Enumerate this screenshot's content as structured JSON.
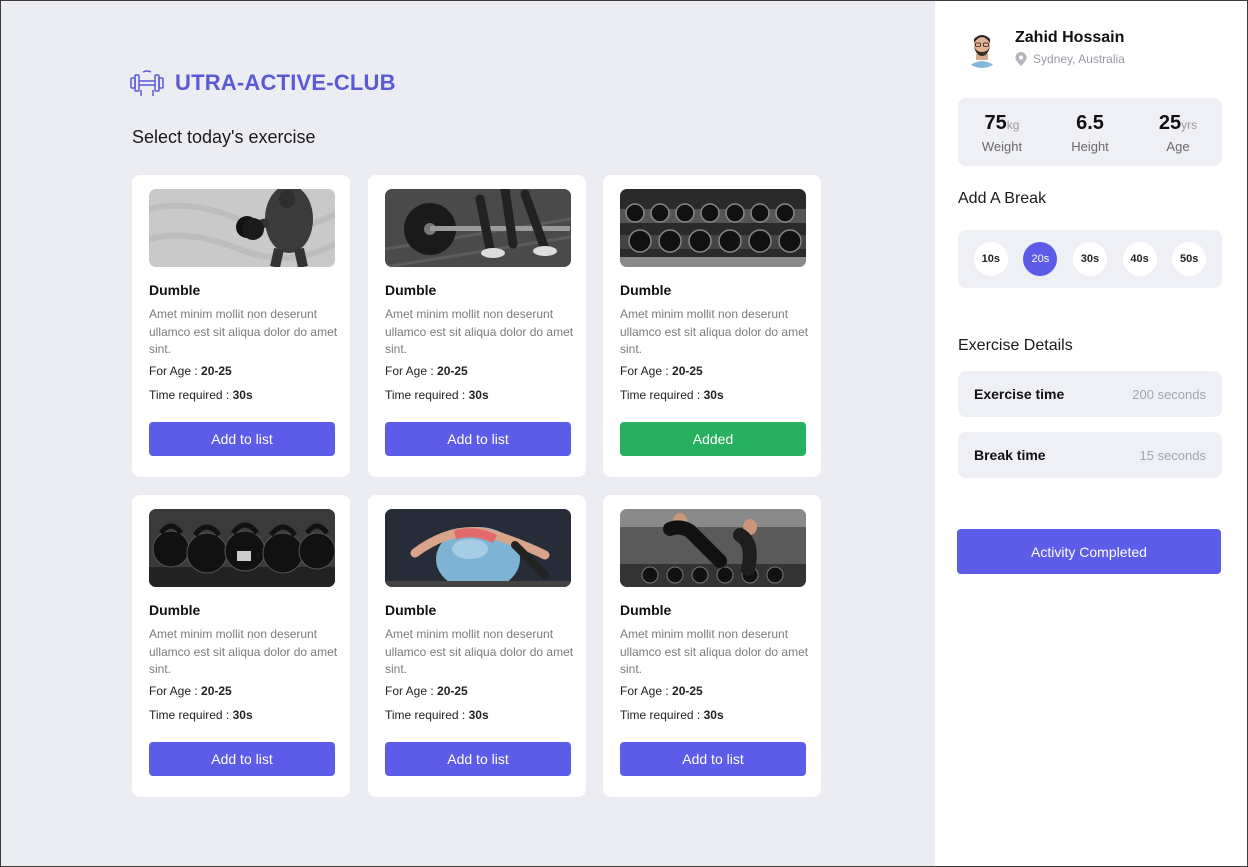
{
  "brand": {
    "name": "UTRA-ACTIVE-CLUB",
    "color": "#5b5ad6",
    "icon": "dumbbell-icon"
  },
  "section_title": "Select today's exercise",
  "labels": {
    "for_age": "For Age : ",
    "time_required": "Time required : "
  },
  "cards": [
    {
      "title": "Dumble",
      "desc": "Amet minim mollit non deserunt ullamco est sit aliqua dolor do amet sint.",
      "age": "20-25",
      "time": "30s",
      "button": "Add to list",
      "added": false,
      "image": "bodybuilder-curl"
    },
    {
      "title": "Dumble",
      "desc": "Amet minim mollit non deserunt ullamco est sit aliqua dolor do amet sint.",
      "age": "20-25",
      "time": "30s",
      "button": "Add to list",
      "added": false,
      "image": "barbell-floor"
    },
    {
      "title": "Dumble",
      "desc": "Amet minim mollit non deserunt ullamco est sit aliqua dolor do amet sint.",
      "age": "20-25",
      "time": "30s",
      "button": "Added",
      "added": true,
      "image": "dumbbell-rack"
    },
    {
      "title": "Dumble",
      "desc": "Amet minim mollit non deserunt ullamco est sit aliqua dolor do amet sint.",
      "age": "20-25",
      "time": "30s",
      "button": "Add to list",
      "added": false,
      "image": "kettlebells"
    },
    {
      "title": "Dumble",
      "desc": "Amet minim mollit non deserunt ullamco est sit aliqua dolor do amet sint.",
      "age": "20-25",
      "time": "30s",
      "button": "Add to list",
      "added": false,
      "image": "exercise-ball"
    },
    {
      "title": "Dumble",
      "desc": "Amet minim mollit non deserunt ullamco est sit aliqua dolor do amet sint.",
      "age": "20-25",
      "time": "30s",
      "button": "Add to list",
      "added": false,
      "image": "gym-trainer"
    }
  ],
  "profile": {
    "name": "Zahid Hossain",
    "location": "Sydney, Australia"
  },
  "stats": [
    {
      "value": "75",
      "unit": "kg",
      "label": "Weight"
    },
    {
      "value": "6.5",
      "unit": "",
      "label": "Height"
    },
    {
      "value": "25",
      "unit": "yrs",
      "label": "Age"
    }
  ],
  "break_section": {
    "title": "Add A Break",
    "options": [
      "10s",
      "20s",
      "30s",
      "40s",
      "50s"
    ],
    "selected": "20s"
  },
  "details": {
    "title": "Exercise Details",
    "exercise_label": "Exercise time",
    "exercise_value": "200 seconds",
    "break_label": "Break time",
    "break_value": "15 seconds"
  },
  "complete_button": "Activity Completed",
  "colors": {
    "primary": "#5c5ce8",
    "added": "#27b05f",
    "main_bg": "#ebedf3"
  }
}
